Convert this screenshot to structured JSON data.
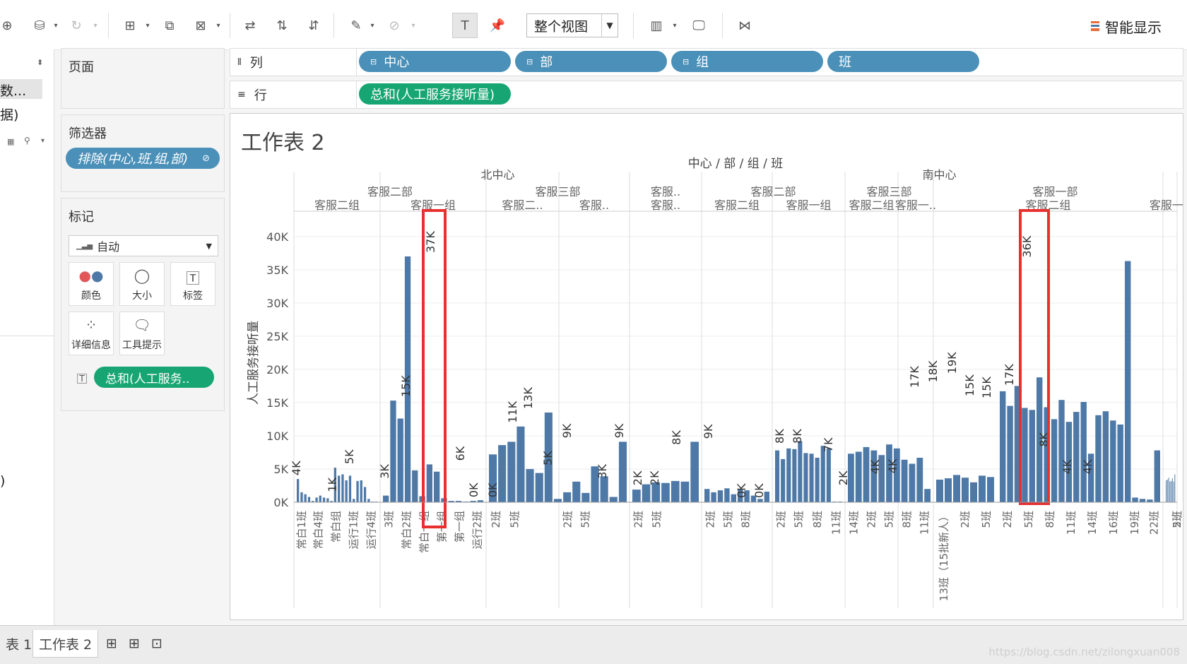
{
  "toolbar": {
    "fit_select": "整个视图",
    "show_me": "智能显示"
  },
  "left_pane": {
    "field1": "数...",
    "field2": "据)"
  },
  "pages_card": {
    "title": "页面"
  },
  "filters_card": {
    "title": "筛选器",
    "filter_pill": "排除(中心,班,组,部)"
  },
  "marks_card": {
    "title": "标记",
    "mark_type": "自动",
    "buttons": [
      "颜色",
      "大小",
      "标签",
      "详细信息",
      "工具提示"
    ],
    "measure_pill": "总和(人工服务.."
  },
  "shelves": {
    "columns_label": "列",
    "column_pills": [
      "中心",
      "部",
      "组",
      "班"
    ],
    "rows_label": "行",
    "row_pill": "总和(人工服务接听量)"
  },
  "sheet_title": "工作表 2",
  "chart_data": {
    "type": "bar",
    "header_title": "中心 / 部 / 组 / 班",
    "ylabel": "人工服务接听量",
    "ylim": [
      0,
      42000
    ],
    "y_ticks": [
      "0K",
      "5K",
      "10K",
      "15K",
      "20K",
      "25K",
      "30K",
      "35K",
      "40K"
    ],
    "centers": [
      {
        "name": "北中心",
        "start": 0,
        "end": 23
      },
      {
        "name": "南中心",
        "start": 23,
        "end": 50
      }
    ],
    "departments": [
      {
        "name": "客服二部",
        "start": 0,
        "end": 11
      },
      {
        "name": "客服三部",
        "start": 11,
        "end": 19
      },
      {
        "name": "客服..",
        "start": 19,
        "end": 23
      },
      {
        "name": "客服二部",
        "start": 23,
        "end": 31
      },
      {
        "name": "客服三部",
        "start": 31,
        "end": 36
      },
      {
        "name": "客服一部",
        "start": 36,
        "end": 50
      }
    ],
    "groups": [
      {
        "name": "客服二组",
        "start": 0,
        "end": 5
      },
      {
        "name": "客服一组",
        "start": 5,
        "end": 11
      },
      {
        "name": "客服二..",
        "start": 11,
        "end": 15
      },
      {
        "name": "客服..",
        "start": 15,
        "end": 19
      },
      {
        "name": "客服..",
        "start": 19,
        "end": 23
      },
      {
        "name": "客服二组",
        "start": 23,
        "end": 27
      },
      {
        "name": "客服一组",
        "start": 27,
        "end": 31
      },
      {
        "name": "客服二组",
        "start": 31,
        "end": 34
      },
      {
        "name": "客服一..",
        "start": 34,
        "end": 36
      },
      {
        "name": "客服二组",
        "start": 36,
        "end": 47
      },
      {
        "name": "客服一..",
        "start": 47,
        "end": 50
      }
    ],
    "x_tick_labels": [
      {
        "seg": 0,
        "text": "常白1班"
      },
      {
        "seg": 1,
        "text": "常白4班"
      },
      {
        "seg": 2,
        "text": "常白组"
      },
      {
        "seg": 3,
        "text": "运行1班"
      },
      {
        "seg": 4,
        "text": "运行4班"
      },
      {
        "seg": 5,
        "text": "3班"
      },
      {
        "seg": 6,
        "text": "常白2班"
      },
      {
        "seg": 7,
        "text": "常白一组"
      },
      {
        "seg": 8,
        "text": "第一组"
      },
      {
        "seg": 9,
        "text": "第一组"
      },
      {
        "seg": 10,
        "text": "运行2班"
      },
      {
        "seg": 11,
        "text": "2班"
      },
      {
        "seg": 12,
        "text": "5班"
      },
      {
        "seg": 15,
        "text": "2班"
      },
      {
        "seg": 16,
        "text": "5班"
      },
      {
        "seg": 19,
        "text": "2班"
      },
      {
        "seg": 20,
        "text": "5班"
      },
      {
        "seg": 23,
        "text": "2班"
      },
      {
        "seg": 24,
        "text": "5班"
      },
      {
        "seg": 25,
        "text": "8班"
      },
      {
        "seg": 27,
        "text": "2班"
      },
      {
        "seg": 28,
        "text": "5班"
      },
      {
        "seg": 29,
        "text": "8班"
      },
      {
        "seg": 30,
        "text": "11班"
      },
      {
        "seg": 31,
        "text": "14班"
      },
      {
        "seg": 32,
        "text": "2班"
      },
      {
        "seg": 33,
        "text": "5班"
      },
      {
        "seg": 34,
        "text": "8班"
      },
      {
        "seg": 35,
        "text": "11班"
      },
      {
        "seg": 36,
        "text": "13班（15批新人）"
      },
      {
        "seg": 37,
        "text": "2班"
      },
      {
        "seg": 38,
        "text": "5班"
      },
      {
        "seg": 39,
        "text": "2班"
      },
      {
        "seg": 40,
        "text": "5班"
      },
      {
        "seg": 41,
        "text": "8班"
      },
      {
        "seg": 42,
        "text": "11班"
      },
      {
        "seg": 43,
        "text": "14班"
      },
      {
        "seg": 44,
        "text": "16班"
      },
      {
        "seg": 45,
        "text": "19班"
      },
      {
        "seg": 46,
        "text": "22班"
      },
      {
        "seg": 48,
        "text": "2班"
      },
      {
        "seg": 49,
        "text": "5班"
      }
    ],
    "panes": [
      {
        "values": [
          3500,
          1500,
          1200,
          800,
          200,
          700,
          1000,
          700,
          600,
          200,
          5200,
          4000,
          4200,
          3300,
          4000,
          500,
          3200,
          3300,
          2300,
          500,
          100,
          100
        ]
      },
      {
        "values": [
          1000,
          15300,
          12600,
          37000,
          4800,
          900,
          5700,
          4600,
          600,
          200,
          200,
          100,
          200,
          300
        ]
      },
      {
        "values": [
          7200,
          8600,
          9100,
          11400,
          5000,
          4400,
          13500,
          500,
          1500,
          3100,
          1400,
          5400,
          3900,
          800,
          9100
        ]
      },
      {
        "values": [
          1900,
          2700,
          3000,
          2900,
          3200,
          3100,
          9100
        ]
      },
      {
        "values": [
          2000,
          1500,
          1800,
          2100,
          1200,
          1900,
          1800,
          1000,
          500,
          1600
        ]
      },
      {
        "values": [
          7800,
          6500,
          8100,
          8000,
          9200,
          7400,
          7300,
          6700,
          8500,
          8100,
          100,
          100
        ]
      },
      {
        "values": [
          7300,
          7600,
          8300,
          7800,
          7100,
          8700,
          8100,
          6400,
          5800,
          6700,
          2000
        ]
      },
      {
        "values": [
          3400,
          3600,
          4100,
          3700,
          3000,
          4000,
          3800
        ]
      },
      {
        "values": [
          16700,
          14500,
          17500,
          14200,
          13900,
          18800,
          14300,
          12500,
          15400,
          12100,
          13600,
          15100,
          7300,
          13100,
          13700,
          12300,
          11700,
          36300,
          700,
          500,
          400,
          7800
        ]
      },
      {
        "values": [
          3300,
          3400,
          3700,
          3100,
          3200,
          3600,
          3100,
          4200
        ]
      }
    ],
    "annotations": [
      "4K",
      "1K",
      "5K",
      "3K",
      "15K",
      "37K",
      "6K",
      "0K",
      "0K",
      "11K",
      "13K",
      "5K",
      "9K",
      "3K",
      "9K",
      "2K",
      "2K",
      "8K",
      "9K",
      "0K",
      "0K",
      "8K",
      "8K",
      "7K",
      "2K",
      "4K",
      "4K",
      "17K",
      "18K",
      "19K",
      "15K",
      "15K",
      "17K",
      "36K",
      "8K",
      "4K",
      "4K"
    ],
    "highlight_color": "#e8302f",
    "bar_color": "#4e79a7"
  },
  "bottom_tabs": [
    "表 1",
    "工作表 2"
  ],
  "watermark": "https://blog.csdn.net/zilongxuan008"
}
